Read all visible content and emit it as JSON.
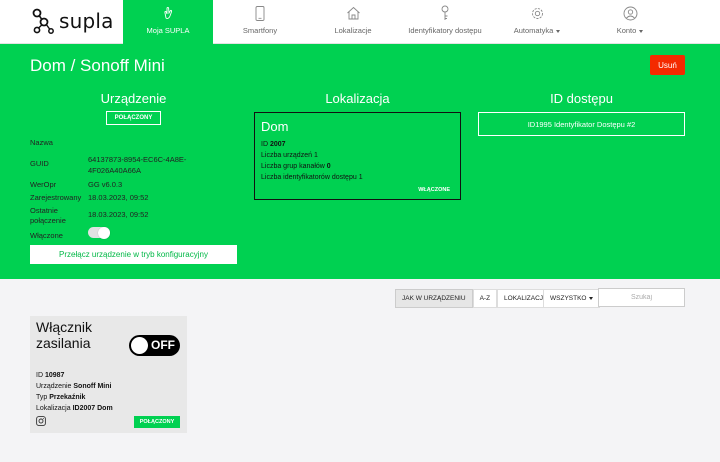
{
  "nav": {
    "brand": "supla",
    "items": [
      {
        "label": "Moja SUPLA",
        "icon": "hand-gesture-icon"
      },
      {
        "label": "Smartfony",
        "icon": "smartphone-icon"
      },
      {
        "label": "Lokalizacje",
        "icon": "home-icon"
      },
      {
        "label": "Identyfikatory dostępu",
        "icon": "key-icon"
      },
      {
        "label": "Automatyka",
        "icon": "gear-icon"
      },
      {
        "label": "Konto",
        "icon": "user-icon"
      }
    ]
  },
  "page": {
    "title": "Dom / Sonoff Mini",
    "delete_label": "Usuń"
  },
  "device": {
    "heading": "Urządzenie",
    "status": "POŁĄCZONY",
    "rows": [
      {
        "label": "Nazwa",
        "value": ""
      },
      {
        "label": "GUID",
        "value": "64137873-8954-EC6C-4A8E-",
        "value2": "4F026A40A66A"
      },
      {
        "label": "WerOpr",
        "value": "GG v6.0.3"
      },
      {
        "label": "Zarejestrowany",
        "value": "18.03.2023, 09:52"
      },
      {
        "label": "Ostatnie",
        "label2": "połączenie",
        "value": "18.03.2023, 09:52"
      },
      {
        "label": "Włączone"
      }
    ],
    "enabled": true,
    "config_button": "Przełącz urządzenie w tryb konfiguracyjny"
  },
  "location": {
    "heading": "Lokalizacja",
    "name": "Dom",
    "id_label": "ID",
    "id_value": "2007",
    "devices_label": "Liczba urządzeń",
    "devices_value": "1",
    "groups_label": "Liczba grup kanałów",
    "groups_value": "0",
    "aids_label": "Liczba identyfikatorów dostępu",
    "aids_value": "1",
    "status": "WŁĄCZONE"
  },
  "access_id": {
    "heading": "ID dostępu",
    "button": "ID1995 Identyfikator Dostępu #2"
  },
  "filters": {
    "sort": [
      "JAK W URZĄDZENIU",
      "A-Z",
      "LOKALIZACJA"
    ],
    "active_sort": 0,
    "scope": "WSZYSTKO",
    "search_placeholder": "Szukaj"
  },
  "channel": {
    "title": "Włącznik zasilania",
    "state": "OFF",
    "id_label": "ID",
    "id_value": "10987",
    "device_label": "Urządzenie",
    "device_value": "Sonoff Mini",
    "type_label": "Typ",
    "type_value": "Przekaźnik",
    "location_label": "Lokalizacja",
    "location_value": "ID2007 Dom",
    "status": "POŁĄCZONY",
    "icon": "instagram-icon"
  },
  "colors": {
    "brand_green": "#00d151",
    "delete_red": "#f42a00"
  }
}
